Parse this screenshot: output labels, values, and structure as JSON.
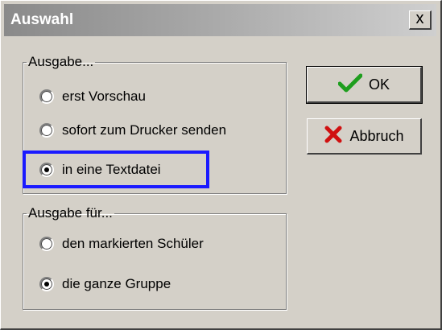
{
  "dialog": {
    "title": "Auswahl",
    "close_label": "x"
  },
  "ausgabe": {
    "legend": "Ausgabe...",
    "options": [
      {
        "label": "erst Vorschau",
        "checked": false
      },
      {
        "label": "sofort zum Drucker senden",
        "checked": false
      },
      {
        "label": "in eine Textdatei",
        "checked": true
      }
    ]
  },
  "ausgabe_fuer": {
    "legend": "Ausgabe für...",
    "options": [
      {
        "label": "den markierten Schüler",
        "checked": false
      },
      {
        "label": "die ganze Gruppe",
        "checked": true
      }
    ]
  },
  "buttons": {
    "ok_label": "OK",
    "cancel_label": "Abbruch",
    "ok_icon": "checkmark-icon",
    "cancel_icon": "x-icon"
  },
  "colors": {
    "highlight": "#1a1aff",
    "check_green": "#1e9e1e",
    "cancel_red": "#d01010"
  }
}
